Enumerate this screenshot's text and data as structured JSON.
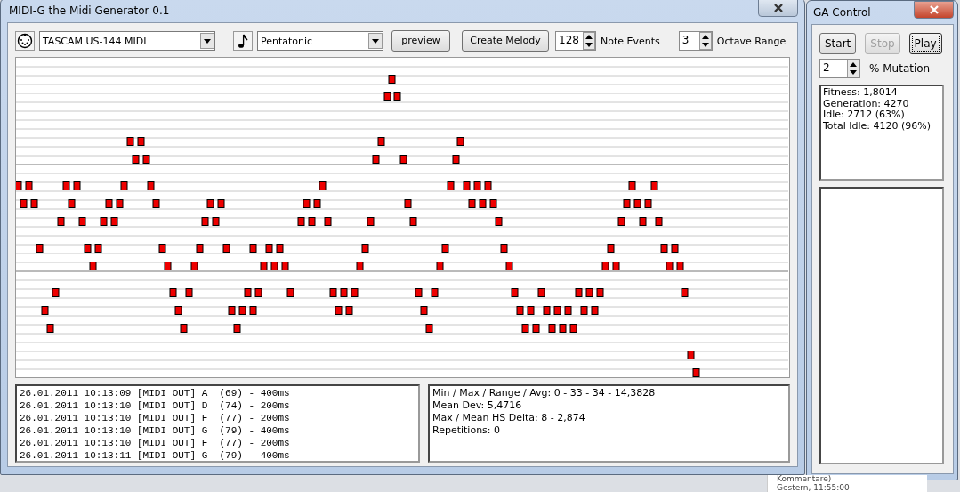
{
  "desktop": {
    "texts": [
      "Kommentare)",
      "Gestern, 11:55:00"
    ]
  },
  "main_window": {
    "title": "MIDI-G the Midi Generator 0.1",
    "toolbar": {
      "device": {
        "value": "TASCAM US-144 MIDI"
      },
      "scale": {
        "value": "Pentatonic"
      },
      "buttons": [
        {
          "label": "preview"
        },
        {
          "label": "Create Melody"
        }
      ],
      "spinners": [
        {
          "value": "128",
          "label": "Note Events"
        },
        {
          "value": "3",
          "label": "Octave Range"
        }
      ]
    },
    "log": [
      "26.01.2011 10:13:09 [MIDI OUT] A  (69) - 400ms",
      "26.01.2011 10:13:10 [MIDI OUT] D  (74) - 200ms",
      "26.01.2011 10:13:10 [MIDI OUT] F  (77) - 200ms",
      "26.01.2011 10:13:10 [MIDI OUT] G  (79) - 400ms",
      "26.01.2011 10:13:10 [MIDI OUT] F  (77) - 200ms",
      "26.01.2011 10:13:11 [MIDI OUT] G  (79) - 400ms"
    ],
    "stats": [
      "Min / Max / Range / Avg: 0 - 33 - 34 - 14,3828",
      "Mean Dev: 5,4716",
      "Max / Mean HS Delta: 8 - 2,874",
      "Repetitions: 0"
    ]
  },
  "ga_window": {
    "title": "GA Control",
    "buttons": [
      {
        "label": "Start",
        "disabled": false,
        "focused": false
      },
      {
        "label": "Stop",
        "disabled": true,
        "focused": false
      },
      {
        "label": "Play",
        "disabled": false,
        "focused": true
      }
    ],
    "mutation": {
      "value": "2",
      "label": "% Mutation"
    },
    "status": [
      "Fitness: 1,8014",
      "Generation: 4270",
      "Idle: 2712 (63%)",
      "Total Idle: 4120 (96%)"
    ]
  }
}
